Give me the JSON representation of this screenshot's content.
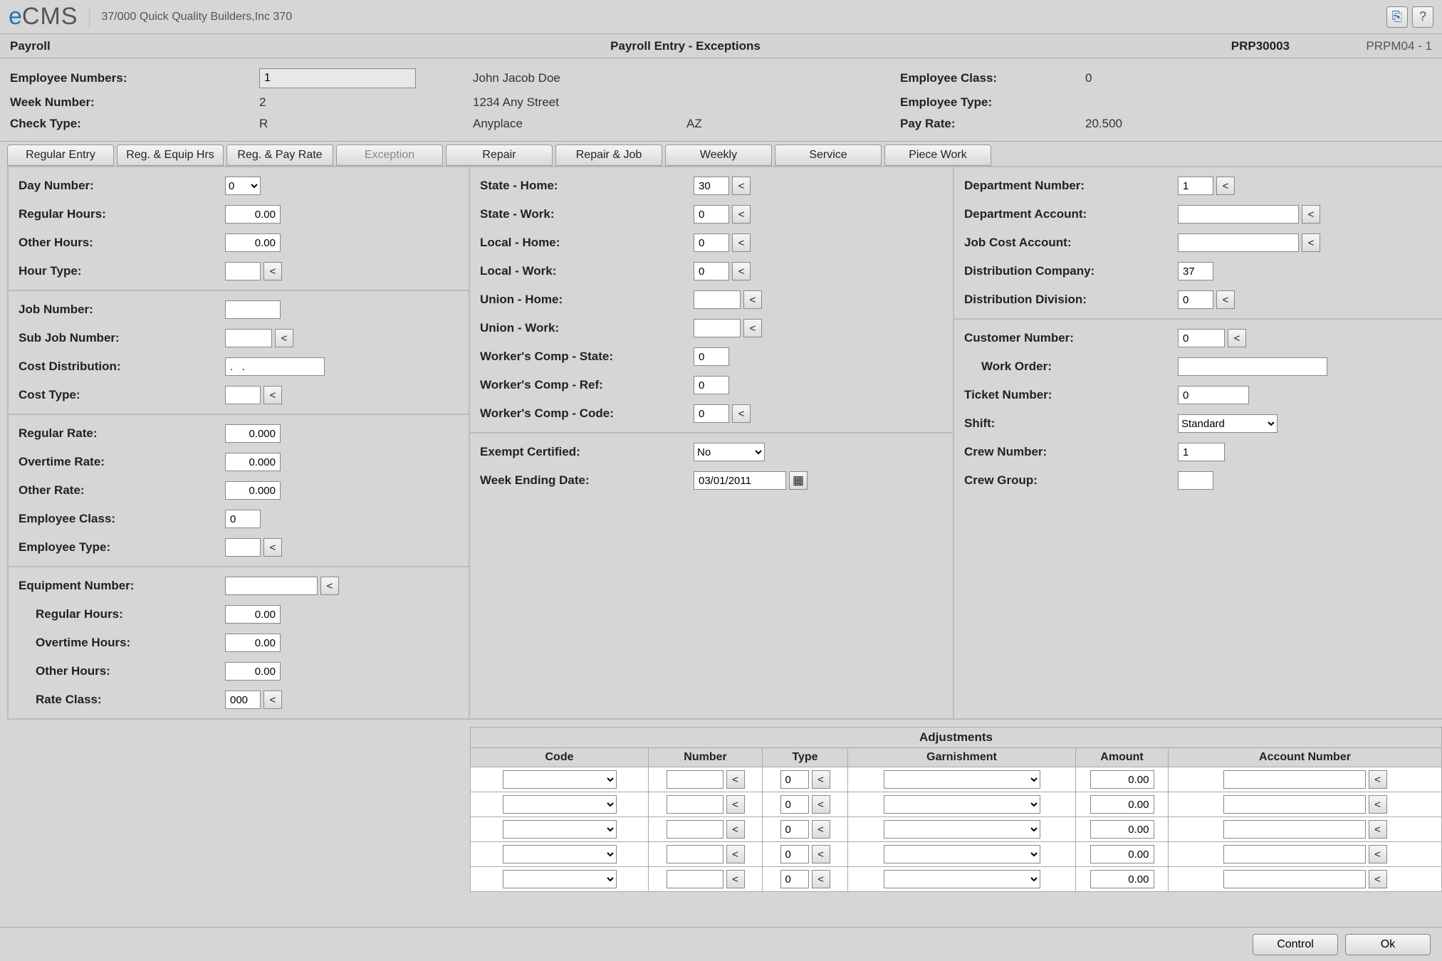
{
  "app": {
    "logo_e": "e",
    "logo_cms": "CMS",
    "crumb": "37/000   Quick Quality Builders,Inc 370",
    "icon_export": "⎘",
    "icon_help": "?"
  },
  "titlebar": {
    "left": "Payroll",
    "center": "Payroll Entry - Exceptions",
    "code": "PRP30003",
    "prog": "PRPM04 - 1"
  },
  "header": {
    "emp_numbers_label": "Employee Numbers:",
    "emp_number_value": "1",
    "emp_name": "John Jacob Doe",
    "emp_class_label": "Employee Class:",
    "emp_class_value": "0",
    "week_label": "Week Number:",
    "week_value": "2",
    "addr_street": "1234 Any Street",
    "emp_type_label": "Employee Type:",
    "emp_type_value": "",
    "check_label": "Check Type:",
    "check_value": "R",
    "addr_city": "Anyplace",
    "addr_state": "AZ",
    "payrate_label": "Pay Rate:",
    "payrate_value": "20.500"
  },
  "tabs": {
    "t0": "Regular Entry",
    "t1": "Reg. & Equip Hrs",
    "t2": "Reg. & Pay Rate",
    "t3": "Exception",
    "t4": "Repair",
    "t5": "Repair & Job",
    "t6": "Weekly",
    "t7": "Service",
    "t8": "Piece Work"
  },
  "col1": {
    "day_label": "Day Number:",
    "day_value": "0",
    "reghrs_label": "Regular Hours:",
    "reghrs_value": "0.00",
    "othhrs_label": "Other Hours:",
    "othhrs_value": "0.00",
    "hourtype_label": "Hour Type:",
    "hourtype_value": "",
    "jobnum_label": "Job Number:",
    "jobnum_value": "",
    "subjob_label": "Sub Job Number:",
    "subjob_value": "",
    "costdist_label": "Cost Distribution:",
    "costdist_value": ".   .",
    "costtype_label": "Cost Type:",
    "costtype_value": "",
    "regrate_label": "Regular Rate:",
    "regrate_value": "0.000",
    "otrate_label": "Overtime Rate:",
    "otrate_value": "0.000",
    "othrate_label": "Other Rate:",
    "othrate_value": "0.000",
    "empclass_label": "Employee Class:",
    "empclass_value": "0",
    "emptype_label": "Employee Type:",
    "emptype_value": "",
    "equip_label": "Equipment Number:",
    "equip_value": "",
    "eq_reghrs_label": "Regular Hours:",
    "eq_reghrs_value": "0.00",
    "eq_othrs_label": "Overtime Hours:",
    "eq_othrs_value": "0.00",
    "eq_otherhrs_label": "Other Hours:",
    "eq_otherhrs_value": "0.00",
    "rateclass_label": "Rate Class:",
    "rateclass_value": "000"
  },
  "col2": {
    "statehome_label": "State - Home:",
    "statehome_value": "30",
    "statework_label": "State - Work:",
    "statework_value": "0",
    "localhome_label": "Local - Home:",
    "localhome_value": "0",
    "localwork_label": "Local - Work:",
    "localwork_value": "0",
    "unionhome_label": "Union - Home:",
    "unionhome_value": "",
    "unionwork_label": "Union - Work:",
    "unionwork_value": "",
    "wcstate_label": "Worker's Comp - State:",
    "wcstate_value": "0",
    "wcref_label": "Worker's Comp - Ref:",
    "wcref_value": "0",
    "wccode_label": "Worker's Comp - Code:",
    "wccode_value": "0",
    "exempt_label": "Exempt Certified:",
    "exempt_value": "No",
    "weekend_label": "Week Ending Date:",
    "weekend_value": "03/01/2011"
  },
  "col3": {
    "deptnum_label": "Department Number:",
    "deptnum_value": "1",
    "deptacct_label": "Department Account:",
    "deptacct_value": "",
    "jcacct_label": "Job Cost Account:",
    "jcacct_value": "",
    "distco_label": "Distribution Company:",
    "distco_value": "37",
    "distdiv_label": "Distribution Division:",
    "distdiv_value": "0",
    "custnum_label": "Customer Number:",
    "custnum_value": "0",
    "wo_label": "Work Order:",
    "wo_value": "",
    "ticket_label": "Ticket Number:",
    "ticket_value": "0",
    "shift_label": "Shift:",
    "shift_value": "Standard",
    "crewnum_label": "Crew Number:",
    "crewnum_value": "1",
    "crewgrp_label": "Crew Group:",
    "crewgrp_value": ""
  },
  "adjust": {
    "title": "Adjustments",
    "hdr_code": "Code",
    "hdr_number": "Number",
    "hdr_type": "Type",
    "hdr_garn": "Garnishment",
    "hdr_amount": "Amount",
    "hdr_acct": "Account Number",
    "rows": [
      {
        "code": "",
        "number": "",
        "type": "0",
        "garn": "",
        "amount": "0.00",
        "acct": ""
      },
      {
        "code": "",
        "number": "",
        "type": "0",
        "garn": "",
        "amount": "0.00",
        "acct": ""
      },
      {
        "code": "",
        "number": "",
        "type": "0",
        "garn": "",
        "amount": "0.00",
        "acct": ""
      },
      {
        "code": "",
        "number": "",
        "type": "0",
        "garn": "",
        "amount": "0.00",
        "acct": ""
      },
      {
        "code": "",
        "number": "",
        "type": "0",
        "garn": "",
        "amount": "0.00",
        "acct": ""
      }
    ]
  },
  "footer": {
    "control": "Control",
    "ok": "Ok"
  },
  "glyphs": {
    "lookup": "<",
    "dropdown": "▾",
    "calendar": "▦"
  }
}
